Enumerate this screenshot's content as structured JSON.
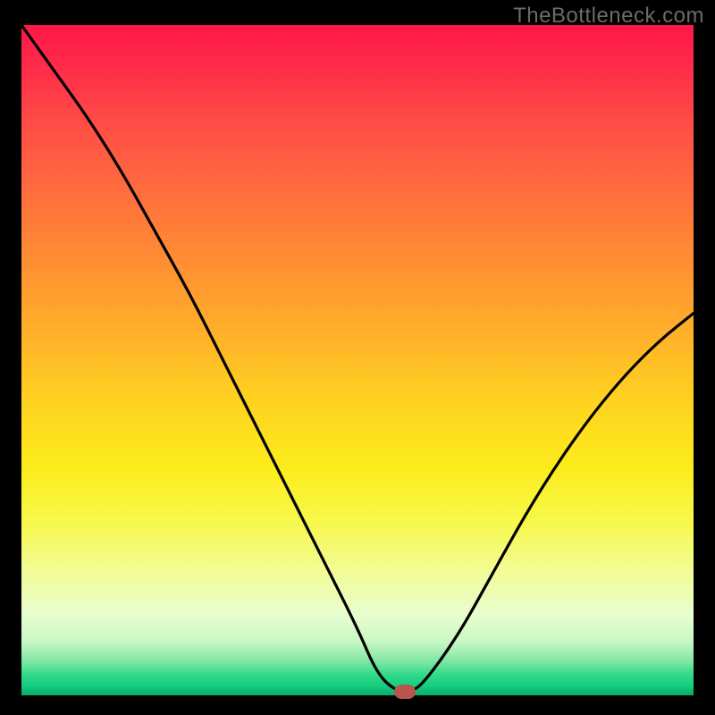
{
  "watermark": "TheBottleneck.com",
  "colors": {
    "frame_bg": "#000000",
    "curve": "#000000",
    "marker": "#b7554e",
    "gradient_top": "#ff1748",
    "gradient_bottom": "#0fb871"
  },
  "chart_data": {
    "type": "line",
    "title": "",
    "xlabel": "",
    "ylabel": "",
    "xlim": [
      0,
      100
    ],
    "ylim": [
      0,
      100
    ],
    "grid": false,
    "legend": false,
    "x": [
      0,
      5,
      10,
      15,
      20,
      25,
      30,
      35,
      40,
      45,
      50,
      53,
      56,
      58,
      60,
      65,
      70,
      75,
      80,
      85,
      90,
      95,
      100
    ],
    "values": [
      100,
      93,
      86,
      78,
      69,
      60,
      50,
      40,
      30,
      20,
      10,
      3,
      0.5,
      0.5,
      2,
      9,
      18,
      27,
      35,
      42,
      48,
      53,
      57
    ],
    "marker": {
      "x": 57,
      "y": 0.5
    },
    "annotations": []
  }
}
